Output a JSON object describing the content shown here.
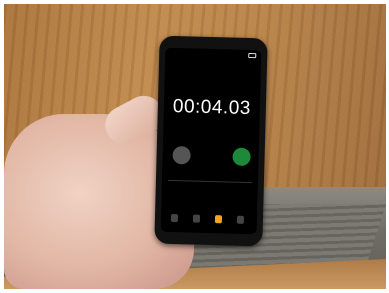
{
  "phone": {
    "status": {
      "carrier": "",
      "time": ""
    },
    "stopwatch": {
      "time": "00:04.03",
      "lap_button": "",
      "start_button": "",
      "page_dots": "",
      "lap_label": "",
      "lap_time": ""
    },
    "tabs": [
      {
        "icon": "world-clock-icon"
      },
      {
        "icon": "alarm-icon"
      },
      {
        "icon": "stopwatch-icon"
      },
      {
        "icon": "timer-icon"
      }
    ],
    "accent_color": "#f3a712",
    "start_color": "#1c8a3a"
  }
}
